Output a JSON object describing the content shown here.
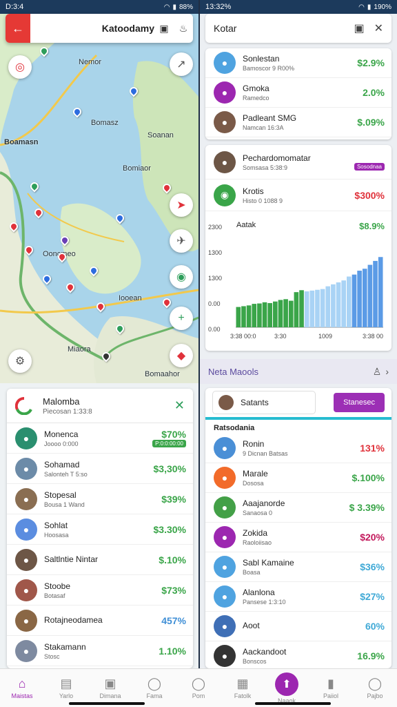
{
  "left": {
    "status": {
      "time": "D:3:4",
      "battery": "88%"
    },
    "search": {
      "value": "Katoodamy"
    },
    "map_labels": [
      "Nemor",
      "Bomasz",
      "Boamasn",
      "Soanan",
      "Bomiaor",
      "Ooncmeo",
      "Iooean",
      "Miaora",
      "Bomaahor"
    ],
    "panel": {
      "title": "Malomba",
      "subtitle": "Piecosan 1:33:8",
      "rows": [
        {
          "name": "Monenca",
          "sub": "Joooo 0:000",
          "value": "$70%",
          "badge": "P:0:0:00:00",
          "color": "#3aa549",
          "avatar": "#2a8f6f"
        },
        {
          "name": "Sohamad",
          "sub": "Salonteh T 5:so",
          "value": "$3,30%",
          "color": "#3aa549",
          "avatar": "#6c8ba8"
        },
        {
          "name": "Stopesal",
          "sub": "Bousa 1 Wand",
          "value": "$39%",
          "color": "#3aa549",
          "avatar": "#8a6e52"
        },
        {
          "name": "Sohlat",
          "sub": "Hoosasa",
          "value": "$3.30%",
          "color": "#3aa549",
          "avatar": "#5b8de0"
        },
        {
          "name": "Saltlntie Nintar",
          "sub": "",
          "value": "$.10%",
          "color": "#3aa549",
          "avatar": "#6d5646"
        },
        {
          "name": "Stoobe",
          "sub": "Botasaf",
          "value": "$73%",
          "color": "#3aa549",
          "avatar": "#a0574a"
        },
        {
          "name": "Rotajneodamea",
          "sub": "",
          "value": "457%",
          "color": "#3f8fd6",
          "avatar": "#8a6745"
        },
        {
          "name": "Stakamann",
          "sub": "Stosc",
          "value": "1.10%",
          "color": "#3aa549",
          "avatar": "#7e8aa0"
        }
      ]
    }
  },
  "right": {
    "status": {
      "time": "13:32%",
      "battery": "190%"
    },
    "header": {
      "title": "Kotar"
    },
    "top_rows": [
      {
        "name": "Sonlestan",
        "sub": "Bamoscor 9 R00%",
        "value": "$2.9%",
        "color": "#3aa549",
        "avatar": "#4fa3e0"
      },
      {
        "name": "Gmoka",
        "sub": "Ramedco",
        "value": "2.0%",
        "color": "#3aa549",
        "avatar": "#9c27b0"
      },
      {
        "name": "Padleant SMG",
        "sub": "Namcan 16:3A",
        "value": "$.09%",
        "color": "#3aa549",
        "avatar": "#7a5a48"
      }
    ],
    "chart_card": {
      "name": "Pechardomomatar",
      "sub": "Somsasa 5:38:9",
      "badge": "Sosodnaa",
      "row2_name": "Krotis",
      "row2_sub": "Histo 0 1088 9",
      "row2_value": "$300%"
    },
    "subheader": {
      "title": "Neta Maools"
    },
    "panel": {
      "search_value": "Satants",
      "button": "Stanesec",
      "section": "Ratsodania",
      "rows": [
        {
          "name": "Ronin",
          "sub": "9 Dicnan Batsas",
          "value": "131%",
          "color": "#e0323b",
          "avatar": "#4a8fd6"
        },
        {
          "name": "Marale",
          "sub": "Dososa",
          "value": "$.100%",
          "color": "#3aa549",
          "avatar": "#f26b2a"
        },
        {
          "name": "Aaajanorde",
          "sub": "Sanaosa 0",
          "value": "$ 3.39%",
          "color": "#3aa549",
          "avatar": "#43a047"
        },
        {
          "name": "Zokida",
          "sub": "Raoloiisao",
          "value": "$20%",
          "color": "#c2185b",
          "avatar": "#9c27b0"
        },
        {
          "name": "Sabl Kamaine",
          "sub": "Boasa",
          "value": "$36%",
          "color": "#3fa9d6",
          "avatar": "#4fa3e0"
        },
        {
          "name": "Alanlona",
          "sub": "Pansese 1:3:10",
          "value": "$27%",
          "color": "#3fa9d6",
          "avatar": "#4fa3e0"
        },
        {
          "name": "Aoot",
          "sub": "",
          "value": "60%",
          "color": "#3fa9d6",
          "avatar": "#3f6fb6"
        },
        {
          "name": "Aackandoot",
          "sub": "Bonscos",
          "value": "16.9%",
          "color": "#3aa549",
          "avatar": "#333"
        }
      ]
    }
  },
  "nav": [
    {
      "label": "Maistas",
      "icon": "home-icon",
      "glyph": "⌂"
    },
    {
      "label": "Yarlo",
      "icon": "list-icon",
      "glyph": "▤"
    },
    {
      "label": "Dimana",
      "icon": "document-icon",
      "glyph": "▣"
    },
    {
      "label": "Fama",
      "icon": "person-icon",
      "glyph": "◯"
    },
    {
      "label": "Pom",
      "icon": "profile-icon",
      "glyph": "◯"
    },
    {
      "label": "Fatolk",
      "icon": "chart-icon",
      "glyph": "▦"
    },
    {
      "label": "Naaok",
      "icon": "add-icon",
      "glyph": "⬆"
    },
    {
      "label": "Paiiol",
      "icon": "file-icon",
      "glyph": "▮"
    },
    {
      "label": "Pajbo",
      "icon": "user-icon",
      "glyph": "◯"
    }
  ],
  "chart_data": {
    "type": "bar",
    "title": "Aatak",
    "value_label": "$8.9%",
    "yticks": [
      "2300",
      "1300",
      "1300",
      "0.00",
      "0.00"
    ],
    "xticks": [
      "3:38 00:0",
      "3:30",
      "1009",
      "3:38 00"
    ],
    "ylim": [
      0,
      2300
    ],
    "series": [
      {
        "color": "#3aa549",
        "values": [
          520,
          540,
          560,
          600,
          610,
          640,
          620,
          660,
          700,
          720,
          680,
          900,
          950
        ]
      },
      {
        "color": "#a9d3f5",
        "values": [
          0,
          0,
          0,
          0,
          0,
          0,
          0,
          0,
          0,
          0,
          0,
          0,
          0,
          920,
          940,
          960,
          980,
          1050,
          1100,
          1150,
          1200,
          1300
        ]
      },
      {
        "color": "#5b9be6",
        "values": [
          0,
          0,
          0,
          0,
          0,
          0,
          0,
          0,
          0,
          0,
          0,
          0,
          0,
          0,
          0,
          0,
          0,
          0,
          0,
          0,
          0,
          0,
          1350,
          1450,
          1500,
          1600,
          1700,
          1800
        ]
      }
    ]
  }
}
